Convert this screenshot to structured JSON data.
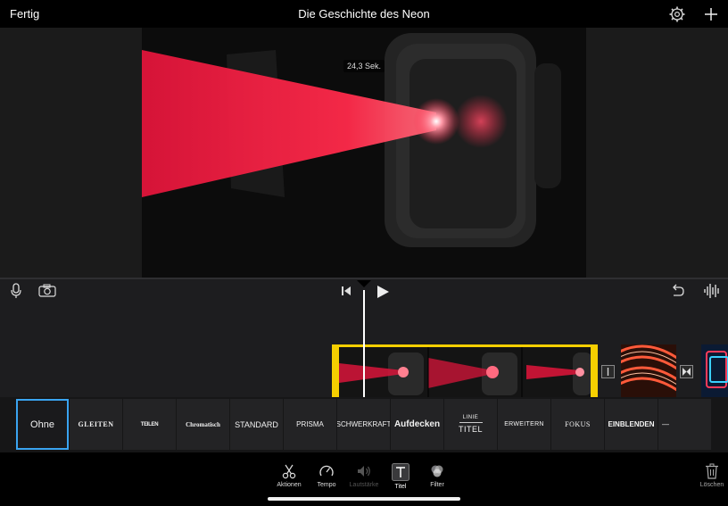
{
  "topbar": {
    "done_label": "Fertig",
    "project_title": "Die Geschichte des Neon",
    "settings_icon": "gear-icon",
    "add_icon": "plus-icon"
  },
  "viewer": {
    "duration": "24,3 Sek."
  },
  "editor": {
    "icons": [
      "microphone-icon",
      "camera-icon",
      "skip-back-icon",
      "play-icon",
      "undo-icon",
      "waveform-icon"
    ],
    "transition_icons": [
      "transition-line-icon",
      "transition-bowtie-icon"
    ]
  },
  "title_styles": [
    {
      "label": "Ohne",
      "selected": true
    },
    {
      "label": "GLEITEN"
    },
    {
      "label": "TEILEN"
    },
    {
      "label": "Chromatisch"
    },
    {
      "label": "STANDARD"
    },
    {
      "label": "PRISMA"
    },
    {
      "label": "SCHWERKRAFT"
    },
    {
      "label": "Aufdecken"
    },
    {
      "label_top": "LINIE",
      "label_bottom": "TITEL"
    },
    {
      "label": "ERWEITERN"
    },
    {
      "label": "FOKUS"
    },
    {
      "label": "EINBLENDEN"
    },
    {
      "label": "—"
    }
  ],
  "toolbar": {
    "actions": "Aktionen",
    "speed": "Tempo",
    "volume": "Lautstärke",
    "titles": "Titel",
    "filters": "Filter",
    "delete": "Löschen"
  },
  "colors": {
    "accent_blue": "#3aa4f0",
    "clip_selection_yellow": "#f6cf00",
    "laser_red": "#ff2a4a"
  }
}
